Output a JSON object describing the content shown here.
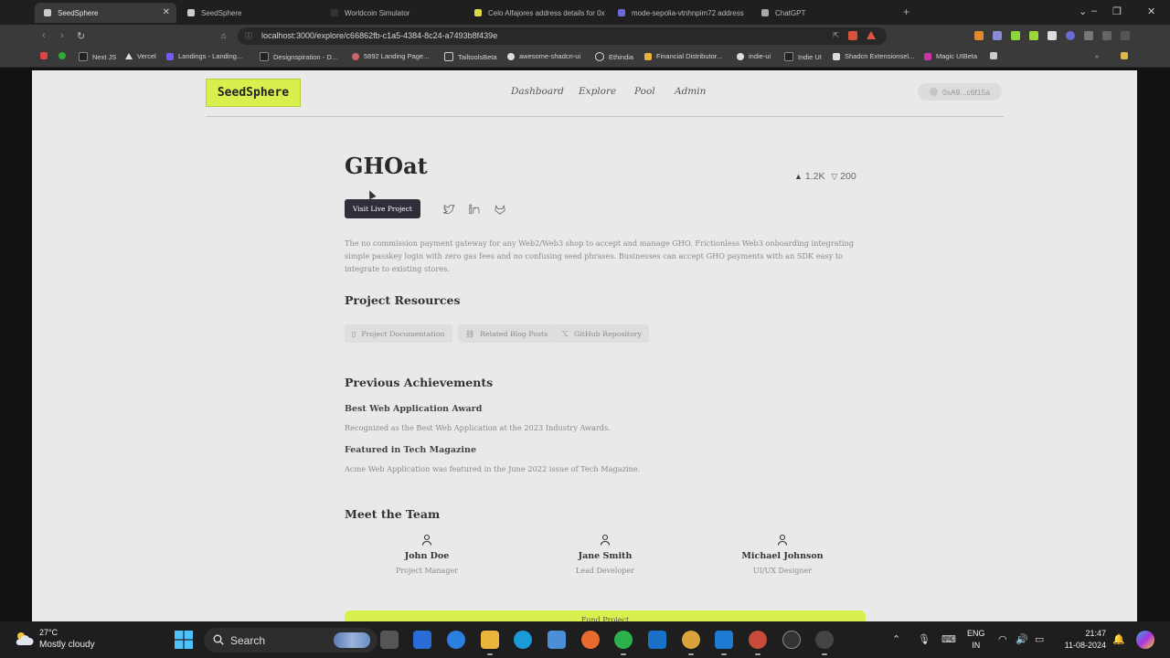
{
  "browser": {
    "tabs": [
      {
        "label": "SeedSphere",
        "color": "#cccccc"
      },
      {
        "label": "SeedSphere",
        "color": "#cccccc"
      },
      {
        "label": "Worldcoin Simulator",
        "color": "#333333"
      },
      {
        "label": "Celo Alfajores address details for 0x",
        "color": "#d9d94a"
      },
      {
        "label": "mode-sepolia-vtnhnpim72 address",
        "color": "#6b6bd6"
      },
      {
        "label": "ChatGPT",
        "color": "#aaaaaa"
      }
    ],
    "url": "localhost:3000/explore/c66862fb-c1a5-4384-8c24-a7493b8f439e",
    "bookmarks": [
      {
        "label": "",
        "color": "#d44"
      },
      {
        "label": "",
        "color": "#3a3"
      },
      {
        "label": "Next JS",
        "color": "#222"
      },
      {
        "label": "Vercel",
        "color": "#222"
      },
      {
        "label": "Landings - Landing...",
        "color": "#7a5af5"
      },
      {
        "label": "Designspiration - D...",
        "color": "#222"
      },
      {
        "label": "5892 Landing Page...",
        "color": "#c66"
      },
      {
        "label": "TailtoolsBeta",
        "color": "#888"
      },
      {
        "label": "awesome-shadcn-ui",
        "color": "#ddd"
      },
      {
        "label": "Ethindia",
        "color": "#ddd"
      },
      {
        "label": "Financial Distributor...",
        "color": "#e9b13a"
      },
      {
        "label": "indie-ui",
        "color": "#ddd"
      },
      {
        "label": "Indie UI",
        "color": "#222"
      },
      {
        "label": "Shadcn Extensionsel...",
        "color": "#ddd"
      },
      {
        "label": "Magic UIBeta",
        "color": "#c3a"
      },
      {
        "label": "",
        "color": "#ccc"
      }
    ]
  },
  "site": {
    "logo": "SeedSphere",
    "nav": [
      "Dashboard",
      "Explore",
      "Pool",
      "Admin"
    ],
    "wallet": "0xA9...c6f15a"
  },
  "project": {
    "title": "GHOat",
    "upvotes": "1.2K",
    "downvotes": "200",
    "live_button": "Visit Live Project",
    "description": "The no commission payment gateway for any Web2/Web3 shop to accept and manage GHO. Frictionless Web3 onboarding integrating simple passkey login with zero gas fees and no confusing seed phrases. Businesses can accept GHO payments with an SDK easy to integrate to existing stores.",
    "resources_heading": "Project Resources",
    "resources": [
      "Project Documentation",
      "Related Blog Posts",
      "GitHub Repository"
    ],
    "achievements_heading": "Previous Achievements",
    "achievements": [
      {
        "title": "Best Web Application Award",
        "desc": "Recognized as the Best Web Application at the 2023 Industry Awards."
      },
      {
        "title": "Featured in Tech Magazine",
        "desc": "Acme Web Application was featured in the June 2022 issue of Tech Magazine."
      }
    ],
    "team_heading": "Meet the Team",
    "team": [
      {
        "name": "John Doe",
        "role": "Project Manager"
      },
      {
        "name": "Jane Smith",
        "role": "Lead Developer"
      },
      {
        "name": "Michael Johnson",
        "role": "UI/UX Designer"
      }
    ],
    "fund_button": "Fund Project"
  },
  "taskbar": {
    "temp": "27°C",
    "weather": "Mostly cloudy",
    "search": "Search",
    "lang1": "ENG",
    "lang2": "IN",
    "time": "21:47",
    "date": "11-08-2024"
  },
  "colors": {
    "accent": "#d9ef4e",
    "dark_button": "#2f2f3a",
    "page_bg": "#e9e9e9"
  }
}
